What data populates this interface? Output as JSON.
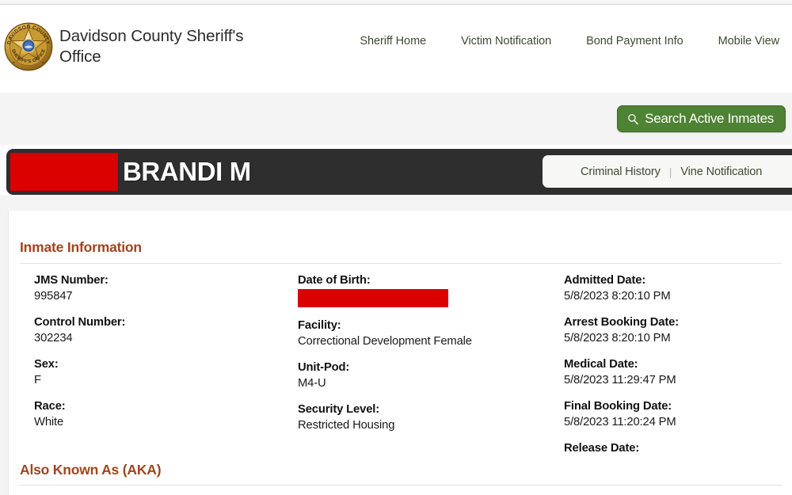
{
  "site": {
    "logo_icon": "sheriff-badge-icon",
    "logo_text_top": "DAVIDSON COUNTY",
    "logo_text_bottom": "SHERIFF'S OFFICE",
    "title": "Davidson County Sheriff's Office"
  },
  "nav": {
    "items": [
      {
        "label": "Sheriff Home"
      },
      {
        "label": "Victim Notification"
      },
      {
        "label": "Bond Payment Info"
      },
      {
        "label": "Mobile View"
      }
    ]
  },
  "toolbar": {
    "search_label": "Search Active Inmates",
    "search_icon": "search-icon",
    "button_color": "#4e8234"
  },
  "banner": {
    "redacted_name": "",
    "inmate_name": "BRANDI M",
    "background_color": "#2e2e2e",
    "redaction_color": "#da0000",
    "links": [
      {
        "label": "Criminal History"
      },
      {
        "label": "Vine Notification"
      }
    ],
    "separator": "|"
  },
  "sections": {
    "inmate_information": {
      "title": "Inmate Information",
      "title_color": "#9e4521",
      "columns": [
        {
          "fields": [
            {
              "label": "JMS Number:",
              "value": "995847",
              "redacted": false
            },
            {
              "label": "Control Number:",
              "value": "302234",
              "redacted": false
            },
            {
              "label": "Sex:",
              "value": "F",
              "redacted": false
            },
            {
              "label": "Race:",
              "value": "White",
              "redacted": false
            }
          ]
        },
        {
          "fields": [
            {
              "label": "Date of Birth:",
              "value": "",
              "redacted": true
            },
            {
              "label": "Facility:",
              "value": "Correctional Development Female",
              "redacted": false
            },
            {
              "label": "Unit-Pod:",
              "value": "M4-U",
              "redacted": false
            },
            {
              "label": "Security Level:",
              "value": "Restricted Housing",
              "redacted": false
            }
          ]
        },
        {
          "fields": [
            {
              "label": "Admitted Date:",
              "value": "5/8/2023 8:20:10 PM",
              "redacted": false
            },
            {
              "label": "Arrest Booking Date:",
              "value": "5/8/2023 8:20:10 PM",
              "redacted": false
            },
            {
              "label": "Medical Date:",
              "value": "5/8/2023 11:29:47 PM",
              "redacted": false
            },
            {
              "label": "Final Booking Date:",
              "value": "5/8/2023 11:20:24 PM",
              "redacted": false
            },
            {
              "label": "Release Date:",
              "value": "",
              "redacted": false
            }
          ]
        }
      ]
    },
    "also_known_as": {
      "title": "Also Known As (AKA)"
    }
  }
}
